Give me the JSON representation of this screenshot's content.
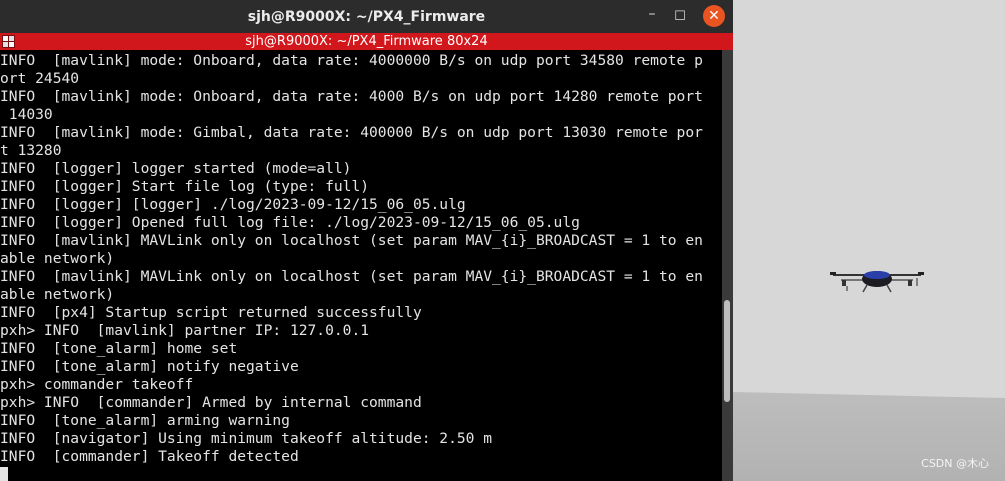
{
  "window": {
    "title": "sjh@R9000X: ~/PX4_Firmware",
    "subtitle": "sjh@R9000X: ~/PX4_Firmware 80x24",
    "minimize_glyph": "–",
    "maximize_glyph": "☐",
    "close_glyph": "✕"
  },
  "terminal": {
    "lines": [
      "INFO  [mavlink] mode: Onboard, data rate: 4000000 B/s on udp port 34580 remote p",
      "ort 24540",
      "INFO  [mavlink] mode: Onboard, data rate: 4000 B/s on udp port 14280 remote port",
      " 14030",
      "INFO  [mavlink] mode: Gimbal, data rate: 400000 B/s on udp port 13030 remote por",
      "t 13280",
      "INFO  [logger] logger started (mode=all)",
      "INFO  [logger] Start file log (type: full)",
      "INFO  [logger] [logger] ./log/2023-09-12/15_06_05.ulg",
      "INFO  [logger] Opened full log file: ./log/2023-09-12/15_06_05.ulg",
      "INFO  [mavlink] MAVLink only on localhost (set param MAV_{i}_BROADCAST = 1 to en",
      "able network)",
      "INFO  [mavlink] MAVLink only on localhost (set param MAV_{i}_BROADCAST = 1 to en",
      "able network)",
      "INFO  [px4] Startup script returned successfully",
      "pxh> INFO  [mavlink] partner IP: 127.0.0.1",
      "INFO  [tone_alarm] home set",
      "INFO  [tone_alarm] notify negative",
      "pxh> commander takeoff",
      "pxh> INFO  [commander] Armed by internal command",
      "INFO  [tone_alarm] arming warning",
      "INFO  [navigator] Using minimum takeoff altitude: 2.50 m",
      "INFO  [commander] Takeoff detected"
    ],
    "scroll_position": 0.76
  },
  "simulation": {
    "watermark": "CSDN @木心"
  },
  "colors": {
    "titlebar": "#2c2c2c",
    "subtitle_bar": "#d1171b",
    "close_button": "#e95420",
    "terminal_bg": "#000000",
    "terminal_fg": "#e4e4e4",
    "drone_accent": "#2a3fa8"
  },
  "icons": [
    "minimize-icon",
    "maximize-icon",
    "close-icon",
    "terminal-app-icon",
    "drone-model"
  ]
}
